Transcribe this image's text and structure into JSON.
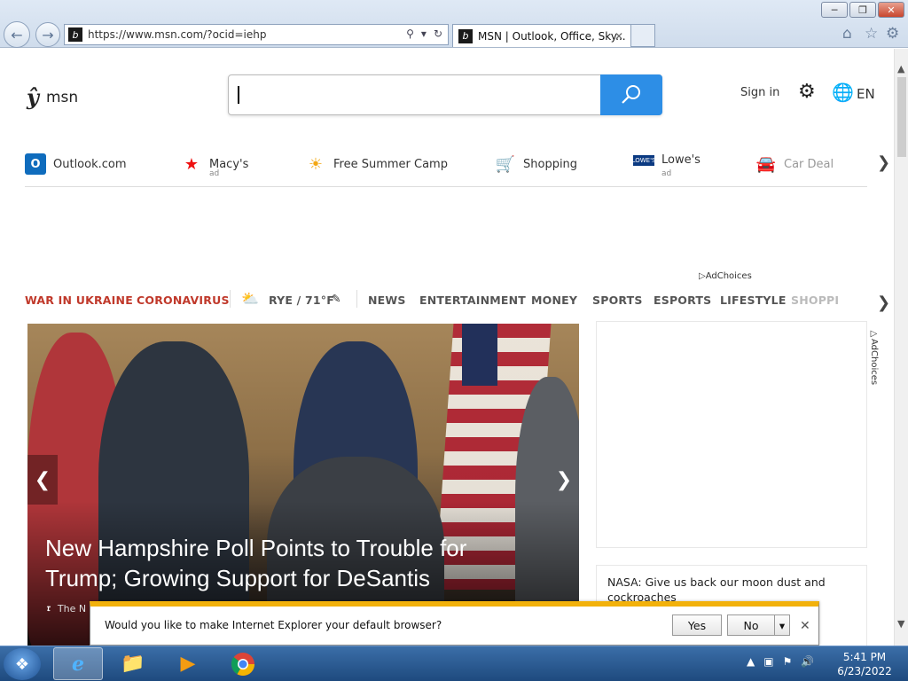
{
  "browser": {
    "url": "https://www.msn.com/?ocid=iehp",
    "tab_title": "MSN | Outlook, Office, Sky...",
    "window_buttons": [
      "minimize",
      "restore",
      "close"
    ]
  },
  "header": {
    "logo_text": "msn",
    "search_placeholder": "",
    "sign_in": "Sign in",
    "language": "EN"
  },
  "quick_links": [
    {
      "label": "Outlook.com",
      "sub": "",
      "icon": "outlook-icon"
    },
    {
      "label": "Macy's",
      "sub": "ad",
      "icon": "macys-icon"
    },
    {
      "label": "Free Summer Camp",
      "sub": "",
      "icon": "sun-icon"
    },
    {
      "label": "Shopping",
      "sub": "",
      "icon": "cart-icon"
    },
    {
      "label": "Lowe's",
      "sub": "ad",
      "icon": "lowes-icon"
    },
    {
      "label": "Car Deal",
      "sub": "",
      "icon": "car-icon"
    }
  ],
  "adchoices": "AdChoices",
  "categories": [
    {
      "label": "WAR IN UKRAINE",
      "highlight": true
    },
    {
      "label": "CORONAVIRUS",
      "highlight": true
    },
    {
      "label": "RYE / 71°F",
      "highlight": false
    },
    {
      "label": "NEWS",
      "highlight": false
    },
    {
      "label": "ENTERTAINMENT",
      "highlight": false
    },
    {
      "label": "MONEY",
      "highlight": false
    },
    {
      "label": "SPORTS",
      "highlight": false
    },
    {
      "label": "ESPORTS",
      "highlight": false
    },
    {
      "label": "LIFESTYLE",
      "highlight": false
    },
    {
      "label": "SHOPPI",
      "highlight": false
    }
  ],
  "hero": {
    "title": "New Hampshire Poll Points to Trouble for Trump; Growing Support for DeSantis",
    "source": "The N"
  },
  "news_card": {
    "text": "NASA: Give us back our moon dust and cockroaches"
  },
  "notification": {
    "message": "Would you like to make Internet Explorer your default browser?",
    "yes": "Yes",
    "no": "No"
  },
  "taskbar": {
    "time": "5:41 PM",
    "date": "6/23/2022"
  }
}
